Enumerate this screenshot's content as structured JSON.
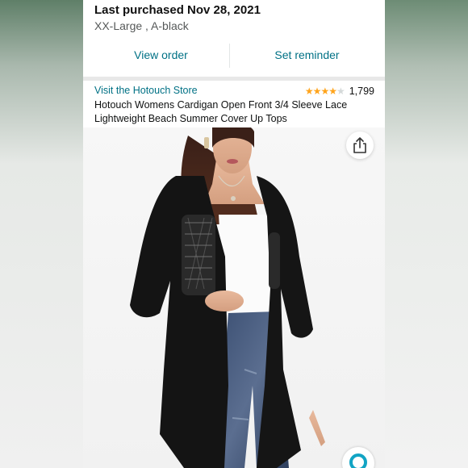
{
  "purchase": {
    "title": "Last purchased Nov 28, 2021",
    "variant": "XX-Large , A-black",
    "view_order": "View order",
    "set_reminder": "Set reminder"
  },
  "product": {
    "store_link": "Visit the Hotouch Store",
    "rating": 4.5,
    "rating_count": "1,799",
    "title": "Hotouch Womens Cardigan Open Front 3/4 Sleeve Lace Lightweight Beach Summer Cover Up Tops"
  },
  "icons": {
    "share": "share-icon",
    "stars": "star-icon"
  },
  "colors": {
    "link": "#007185",
    "star": "#ffa41c",
    "accent": "#12a4c4"
  }
}
